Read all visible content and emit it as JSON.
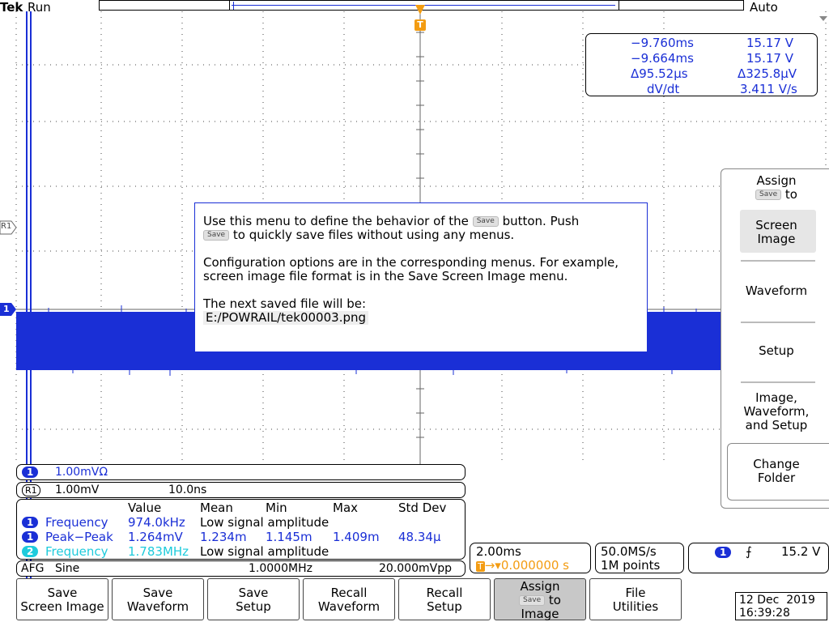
{
  "header": {
    "brand": "Tek",
    "run_state": "Run",
    "trigger_mode": "Auto",
    "trigger_marker": "T"
  },
  "cursor_readout": {
    "t1": "−9.760ms",
    "v1": "15.17 V",
    "t2": "−9.664ms",
    "v2": "15.17 V",
    "dt": "Δ95.52µs",
    "dv": "Δ325.8µV",
    "rate_label": "dV/dt",
    "rate_value": "3.411 V/s"
  },
  "channel_markers": {
    "ref": "R1",
    "ch1": "1"
  },
  "info_dialog": {
    "line1_a": "Use this menu to define the behavior of the",
    "save_chip": "Save",
    "line1_b": "button. Push",
    "line2": "to quickly save files without using any menus.",
    "para2": "Configuration options are in the corresponding menus. For example, screen image file format is in the Save Screen Image menu.",
    "next_label": "The next saved file will be:",
    "next_file": "E:/POWRAIL/tek00003.png"
  },
  "side_menu": {
    "title": "Assign",
    "title_suffix": "to",
    "save_chip": "Save",
    "items": [
      {
        "label": "Screen\nImage",
        "selected": true
      },
      {
        "label": "Waveform",
        "selected": false
      },
      {
        "label": "Setup",
        "selected": false
      },
      {
        "label": "Image,\nWaveform,\nand Setup",
        "selected": false
      }
    ],
    "change_folder": "Change\nFolder"
  },
  "channels": {
    "ch1_badge": "1",
    "ch1_scale": "1.00mVΩ",
    "ref_badge": "R1",
    "ref_scale": "1.00mV",
    "ref_time": "10.0ns"
  },
  "measurements": {
    "headers": [
      "Value",
      "Mean",
      "Min",
      "Max",
      "Std Dev"
    ],
    "rows": [
      {
        "badge": "1",
        "name": "Frequency",
        "value": "974.0kHz",
        "rest": "Low signal amplitude",
        "color": "blue"
      },
      {
        "badge": "1",
        "name": "Peak−Peak",
        "value": "1.264mV",
        "mean": "1.234m",
        "min": "1.145m",
        "max": "1.409m",
        "std": "48.34µ",
        "color": "blue"
      },
      {
        "badge": "2",
        "name": "Frequency",
        "value": "1.783MHz",
        "rest": "Low signal amplitude",
        "color": "cyan"
      }
    ]
  },
  "afg": {
    "label": "AFG",
    "wave": "Sine",
    "freq": "1.0000MHz",
    "amp": "20.000mVpp"
  },
  "horizontal": {
    "scale": "2.00ms",
    "trig_pos": "0.000000 s",
    "sample_rate": "50.0MS/s",
    "record_length": "1M points"
  },
  "trigger": {
    "badge": "1",
    "slope": "⨍",
    "level": "15.2 V"
  },
  "softkeys": [
    "Save\nScreen Image",
    "Save\nWaveform",
    "Save\nSetup",
    "Recall\nWaveform",
    "Recall\nSetup",
    "Assign\n{save} to\nImage",
    "File\nUtilities"
  ],
  "softkey_save_chip": "Save",
  "datetime": {
    "date": "12 Dec  2019",
    "time": "16:39:28"
  },
  "colors": {
    "ch1": "#1a2fd6",
    "ch2": "#1ecbdc",
    "trigger": "#f39c12",
    "active_softkey": "#c8c8c8"
  }
}
